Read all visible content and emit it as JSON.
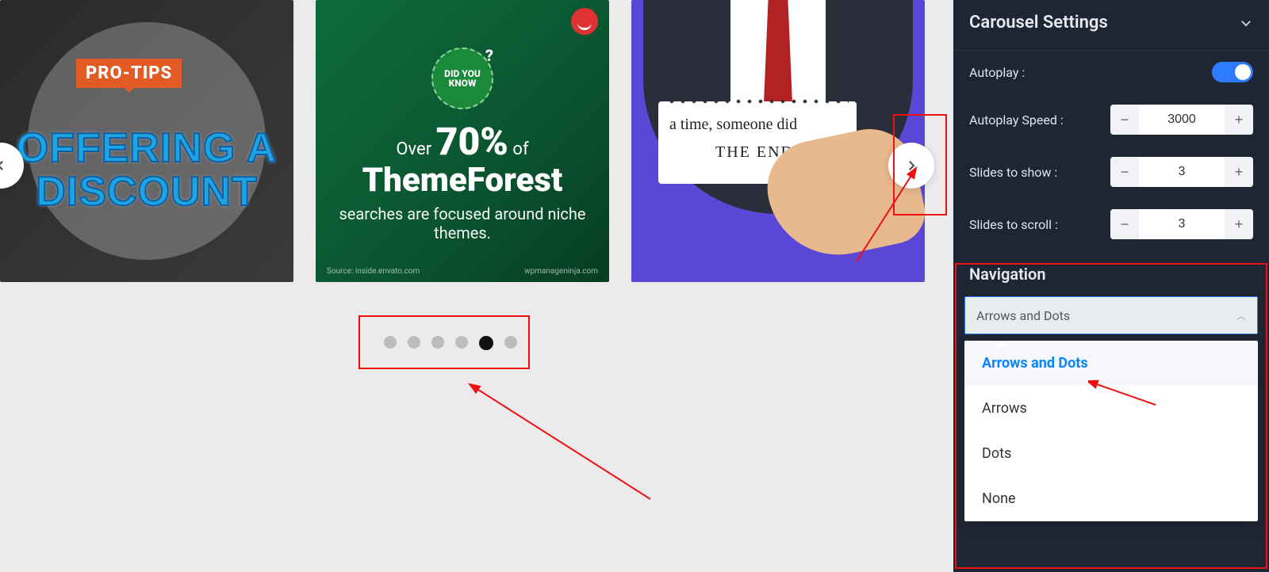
{
  "carousel": {
    "slides": [
      {
        "badge": "PRO-TIPS",
        "headline_line1": "OFFERING A",
        "headline_line2": "DISCOUNT"
      },
      {
        "didyou_line1": "DID YOU",
        "didyou_line2": "KNOW",
        "line1_pre": "Over ",
        "line1_big": "70%",
        "line1_post": " of",
        "line2": "ThemeForest",
        "line3": "searches are focused around niche themes.",
        "footer_left": "Source: inside.envato.com",
        "footer_right": "wpmanageninja.com"
      },
      {
        "note_line1": "a time, someone did",
        "note_end": "THE END."
      }
    ],
    "dots": {
      "count": 6,
      "active_index": 4
    }
  },
  "panel": {
    "title": "Carousel Settings",
    "autoplay_label": "Autoplay :",
    "autoplay_on": true,
    "speed_label": "Autoplay Speed :",
    "speed_value": "3000",
    "slides_show_label": "Slides to show :",
    "slides_show_value": "3",
    "slides_scroll_label": "Slides to scroll :",
    "slides_scroll_value": "3",
    "navigation_label": "Navigation",
    "navigation_selected": "Arrows and Dots",
    "navigation_options": [
      "Arrows and Dots",
      "Arrows",
      "Dots",
      "None"
    ]
  }
}
